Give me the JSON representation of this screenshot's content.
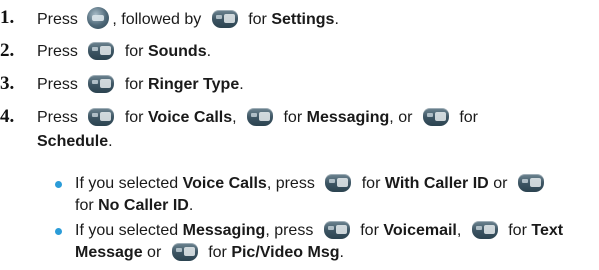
{
  "steps": [
    {
      "number": "1.",
      "press": "Press",
      "followed_by": ", followed by",
      "for": "for",
      "target": "Settings",
      "end": "."
    },
    {
      "number": "2.",
      "press": "Press",
      "for": "for",
      "target": "Sounds",
      "end": "."
    },
    {
      "number": "3.",
      "press": "Press",
      "for": "for",
      "target": "Ringer Type",
      "end": "."
    },
    {
      "number": "4.",
      "press": "Press",
      "for1": "for",
      "target1": "Voice Calls",
      "sep1": ",",
      "for2": "for",
      "target2": "Messaging",
      "or": ", or",
      "for3": "for",
      "target3": "Schedule",
      "end": "."
    }
  ],
  "bullets": [
    {
      "pre": "If you selected",
      "sel": "Voice Calls",
      "press": ", press",
      "for1": "for",
      "opt1": "With Caller ID",
      "or": "or",
      "for2": "for",
      "opt2": "No Caller ID",
      "end": "."
    },
    {
      "pre": "If you selected",
      "sel": "Messaging",
      "press": ", press",
      "for1": "for",
      "opt1": "Voicemail",
      "sep": ",",
      "for2": "for",
      "opt2a": "Text",
      "opt2b": "Message",
      "or": "or",
      "for3": "for",
      "opt3": "Pic/Video Msg",
      "end": "."
    }
  ],
  "icons": {
    "menu_ok": "menu-ok-key-icon",
    "key_1": "key-1-icon",
    "key_2": "key-2-icon",
    "key_3": "key-3-icon",
    "key_hash": "key-hash-icon"
  },
  "colors": {
    "bullet": "#2b9cd8",
    "key": "#3b5361"
  }
}
